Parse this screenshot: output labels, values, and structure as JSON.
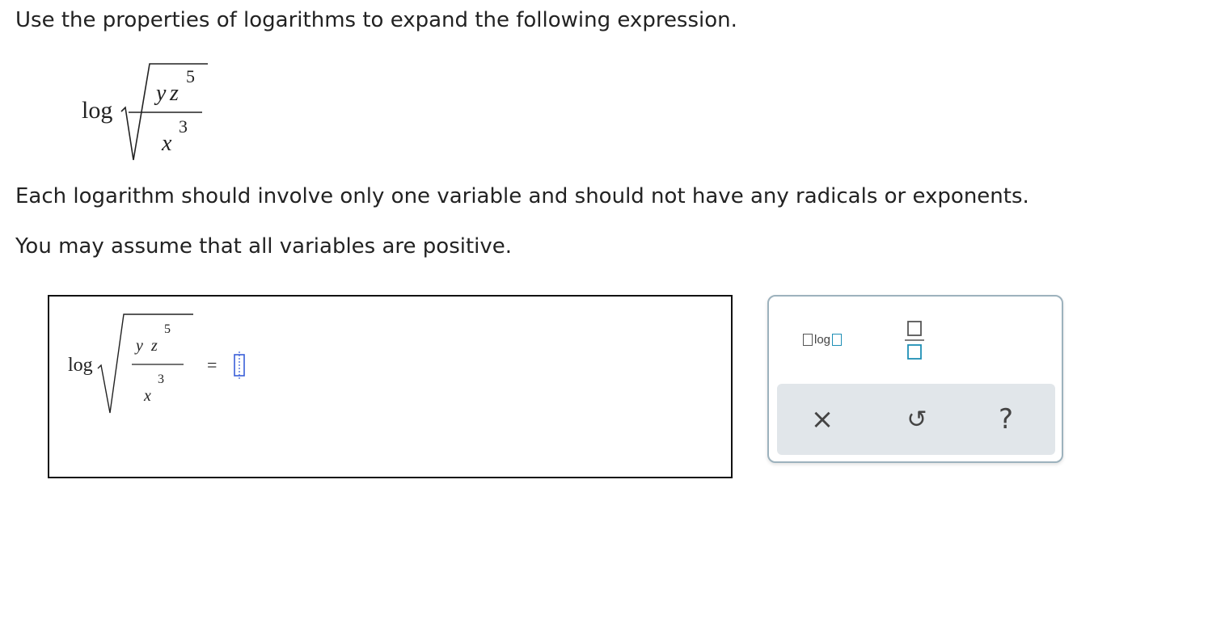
{
  "instructions": {
    "line1": "Use the properties of logarithms to expand the following expression.",
    "line2": "Each logarithm should involve only one variable and should not have any radicals or exponents.",
    "line3": "You may assume that all variables are positive."
  },
  "expression": {
    "func": "log",
    "num_var1": "y",
    "num_var2": "z",
    "num_exp": "5",
    "den_var": "x",
    "den_exp": "3"
  },
  "answer": {
    "func": "log",
    "num_var1": "y",
    "num_var2": "z",
    "num_exp": "5",
    "den_var": "x",
    "den_exp": "3",
    "equals": "=",
    "value": ""
  },
  "keypad": {
    "log_button": {
      "label": "log",
      "icon": "log-template-icon"
    },
    "fraction_button": {
      "icon": "fraction-template-icon"
    },
    "clear_button": {
      "glyph": "×",
      "icon": "clear-icon"
    },
    "undo_button": {
      "glyph": "↺",
      "icon": "undo-icon"
    },
    "help_button": {
      "glyph": "?",
      "icon": "help-icon"
    }
  },
  "colors": {
    "cursor_blue": "#3a5fd9",
    "template_teal": "#1e8fb5",
    "keypad_border": "#9db2bd",
    "keypad_action_bg": "#e1e6ea"
  }
}
